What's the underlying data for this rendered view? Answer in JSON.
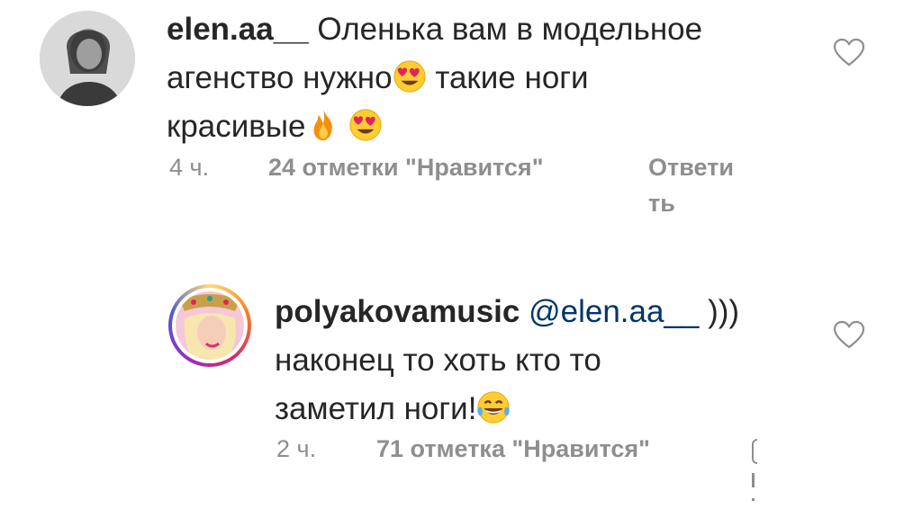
{
  "comments": [
    {
      "username": "elen.aa__",
      "text_line1": "Оленька вам в модельное",
      "text_line2a": "агенство нужно",
      "text_line2b": " такие ноги",
      "text_line3": "красивые",
      "time": "4 ч.",
      "likes": "24 отметки \"Нравится\"",
      "reply_label_1": "Ответи",
      "reply_label_2": "ть",
      "icons": [
        "heart-eyes-emoji",
        "fire-emoji",
        "heart-eyes-emoji",
        "heart-outline-icon"
      ]
    },
    {
      "username": "polyakovamusic",
      "mention": "@elen.aa__",
      "text_tail": " )))",
      "text_line2": "наконец то хоть кто то",
      "text_line3": "заметил ноги!",
      "time": "2 ч.",
      "likes": "71 отметка \"Нравится\"",
      "icons": [
        "tears-of-joy-emoji",
        "heart-outline-icon"
      ]
    }
  ],
  "colors": {
    "text": "#262626",
    "muted": "#8e8e8e",
    "mention": "#003569",
    "story_ring": "#e1306c"
  }
}
